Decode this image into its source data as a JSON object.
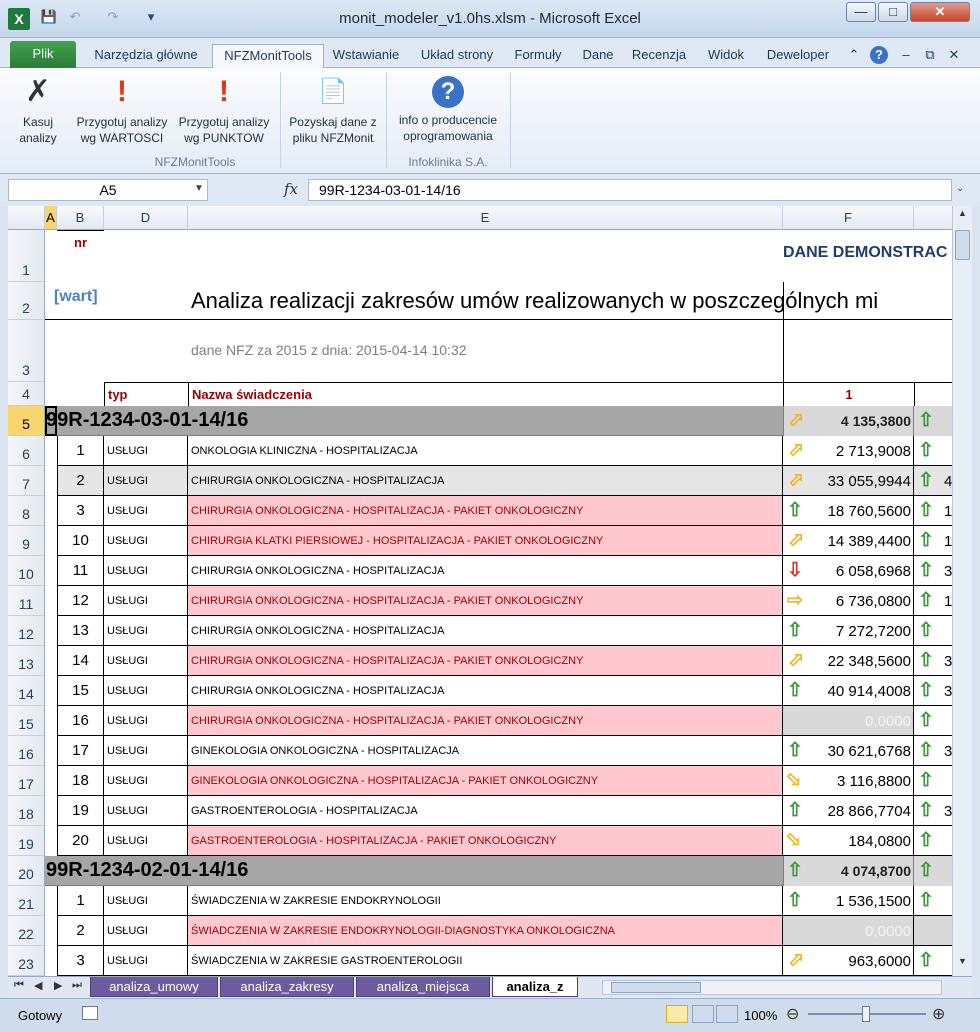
{
  "window": {
    "title": "monit_modeler_v1.0hs.xlsm  -  Microsoft Excel"
  },
  "tabs": [
    "Plik",
    "Narzędzia główne",
    "NFZMonitTools",
    "Wstawianie",
    "Układ strony",
    "Formuły",
    "Dane",
    "Recenzja",
    "Widok",
    "Deweloper"
  ],
  "ribbon": {
    "buttons": [
      {
        "label1": "Kasuj",
        "label2": "analizy"
      },
      {
        "label1": "Przygotuj analizy",
        "label2": "wg WARTOSCI"
      },
      {
        "label1": "Przygotuj analizy",
        "label2": "wg PUNKTOW"
      },
      {
        "label1": "Pozyskaj dane z",
        "label2": "pliku NFZMonit"
      },
      {
        "label1": "info o producencie",
        "label2": "oprogramowania"
      }
    ],
    "groups": [
      "NFZMonitTools",
      "Infoklinika S.A."
    ]
  },
  "formula_bar": {
    "name_box": "A5",
    "fx": "fx",
    "formula": "99R-1234-03-01-14/16"
  },
  "columns": [
    "A",
    "B",
    "D",
    "E",
    "F"
  ],
  "header": {
    "demo": "DANE DEMONSTRAC",
    "wart": "[wart]",
    "title": "Analiza realizacji zakresów umów realizowanych w poszczególnych mi",
    "subtitle": "dane NFZ za 2015 z dnia: 2015-04-14 10:32",
    "col_nr": "nr",
    "col_typ": "typ",
    "col_name": "Nazwa świadczenia",
    "col_f": "1"
  },
  "rows": [
    {
      "row": "5",
      "group": true,
      "code": "99R-1234-03-01-14/16",
      "arrow": "up-right",
      "value": "4 135,3800",
      "arrow2": "up",
      "extra": ""
    },
    {
      "row": "6",
      "nr": "1",
      "typ": "USŁUGI",
      "name": "ONKOLOGIA KLINICZNA - HOSPITALIZACJA",
      "pink": false,
      "arrow": "up-right",
      "value": "2 713,9008",
      "arrow2": "up",
      "extra": ""
    },
    {
      "row": "7",
      "nr": "2",
      "typ": "USŁUGI",
      "name": "CHIRURGIA ONKOLOGICZNA - HOSPITALIZACJA",
      "pink": false,
      "gray": true,
      "arrow": "up-right",
      "value": "33 055,9944",
      "arrow2": "up",
      "extra": "4"
    },
    {
      "row": "8",
      "nr": "3",
      "typ": "USŁUGI",
      "name": "CHIRURGIA ONKOLOGICZNA - HOSPITALIZACJA - PAKIET ONKOLOGICZNY",
      "pink": true,
      "arrow": "up",
      "value": "18 760,5600",
      "arrow2": "up",
      "extra": "1"
    },
    {
      "row": "9",
      "nr": "10",
      "typ": "USŁUGI",
      "name": "CHIRURGIA KLATKI PIERSIOWEJ - HOSPITALIZACJA - PAKIET ONKOLOGICZNY",
      "pink": true,
      "arrow": "up-right",
      "value": "14 389,4400",
      "arrow2": "up",
      "extra": "1"
    },
    {
      "row": "10",
      "nr": "11",
      "typ": "USŁUGI",
      "name": "CHIRURGIA ONKOLOGICZNA - HOSPITALIZACJA",
      "pink": false,
      "arrow": "down",
      "value": "6 058,6968",
      "arrow2": "up",
      "extra": "3"
    },
    {
      "row": "11",
      "nr": "12",
      "typ": "USŁUGI",
      "name": "CHIRURGIA ONKOLOGICZNA - HOSPITALIZACJA - PAKIET ONKOLOGICZNY",
      "pink": true,
      "arrow": "right",
      "value": "6 736,0800",
      "arrow2": "up",
      "extra": "1"
    },
    {
      "row": "12",
      "nr": "13",
      "typ": "USŁUGI",
      "name": "CHIRURGIA ONKOLOGICZNA - HOSPITALIZACJA",
      "pink": false,
      "arrow": "up",
      "value": "7 272,7200",
      "arrow2": "up",
      "extra": ""
    },
    {
      "row": "13",
      "nr": "14",
      "typ": "USŁUGI",
      "name": "CHIRURGIA ONKOLOGICZNA - HOSPITALIZACJA - PAKIET ONKOLOGICZNY",
      "pink": true,
      "arrow": "up-right",
      "value": "22 348,5600",
      "arrow2": "up",
      "extra": "3"
    },
    {
      "row": "14",
      "nr": "15",
      "typ": "USŁUGI",
      "name": "CHIRURGIA ONKOLOGICZNA - HOSPITALIZACJA",
      "pink": false,
      "arrow": "up",
      "value": "40 914,4008",
      "arrow2": "up",
      "extra": "3"
    },
    {
      "row": "15",
      "nr": "16",
      "typ": "USŁUGI",
      "name": "CHIRURGIA ONKOLOGICZNA - HOSPITALIZACJA - PAKIET ONKOLOGICZNY",
      "pink": true,
      "arrow": "none",
      "value": "0,0000",
      "zero": true,
      "arrow2": "up",
      "extra": ""
    },
    {
      "row": "16",
      "nr": "17",
      "typ": "USŁUGI",
      "name": "GINEKOLOGIA ONKOLOGICZNA - HOSPITALIZACJA",
      "pink": false,
      "arrow": "up",
      "value": "30 621,6768",
      "arrow2": "up",
      "extra": "3"
    },
    {
      "row": "17",
      "nr": "18",
      "typ": "USŁUGI",
      "name": "GINEKOLOGIA ONKOLOGICZNA - HOSPITALIZACJA - PAKIET ONKOLOGICZNY",
      "pink": true,
      "arrow": "down-right",
      "value": "3 116,8800",
      "arrow2": "up",
      "extra": ""
    },
    {
      "row": "18",
      "nr": "19",
      "typ": "USŁUGI",
      "name": "GASTROENTEROLOGIA - HOSPITALIZACJA",
      "pink": false,
      "arrow": "up",
      "value": "28 866,7704",
      "arrow2": "up",
      "extra": "3"
    },
    {
      "row": "19",
      "nr": "20",
      "typ": "USŁUGI",
      "name": "GASTROENTEROLOGIA - HOSPITALIZACJA - PAKIET ONKOLOGICZNY",
      "pink": true,
      "arrow": "down-right",
      "value": "184,0800",
      "arrow2": "up",
      "extra": ""
    },
    {
      "row": "20",
      "group": true,
      "code": "99R-1234-02-01-14/16",
      "arrow": "up",
      "value": "4 074,8700",
      "arrow2": "up",
      "extra": ""
    },
    {
      "row": "21",
      "nr": "1",
      "typ": "USŁUGI",
      "name": "ŚWIADCZENIA W ZAKRESIE ENDOKRYNOLOGII",
      "pink": false,
      "arrow": "up",
      "value": "1 536,1500",
      "arrow2": "up",
      "extra": ""
    },
    {
      "row": "22",
      "nr": "2",
      "typ": "USŁUGI",
      "name": "ŚWIADCZENIA W ZAKRESIE ENDOKRYNOLOGII-DIAGNOSTYKA ONKOLOGICZNA",
      "pink": true,
      "arrow": "none",
      "value": "0,0000",
      "zero": true,
      "arrow2": "none",
      "extra": ""
    },
    {
      "row": "23",
      "nr": "3",
      "typ": "USŁUGI",
      "name": "ŚWIADCZENIA W ZAKRESIE GASTROENTEROLOGII",
      "pink": false,
      "arrow": "up-right",
      "value": "963,6000",
      "arrow2": "up",
      "extra": ""
    }
  ],
  "sheet_tabs": [
    "analiza_umowy",
    "analiza_zakresy",
    "analiza_miejsca",
    "analiza_z"
  ],
  "status": {
    "ready": "Gotowy",
    "zoom": "100%"
  },
  "colors": {
    "green": "#3a9a3a",
    "orange": "#f3b52b",
    "red": "#d9322b",
    "pink": "#ffc7ce",
    "darkred": "#9c0006",
    "group_gray": "#a6a6a6",
    "blue": "#1f3d6b"
  }
}
